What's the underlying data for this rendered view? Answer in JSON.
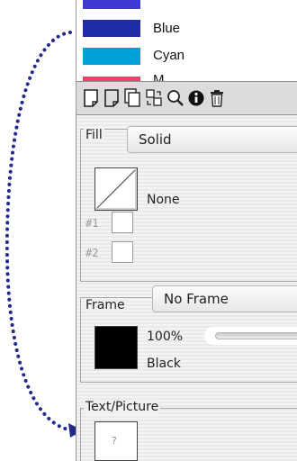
{
  "swatches": [
    {
      "label": "",
      "color": "#3f3ad6"
    },
    {
      "label": "Blue",
      "color": "#1f2aa7"
    },
    {
      "label": "Cyan",
      "color": "#00a2d8"
    },
    {
      "label": "M",
      "color": "#e6456c"
    }
  ],
  "toolbar": {
    "icons": [
      "new-page-icon",
      "page-icon",
      "duplicate-icon",
      "swap-icon",
      "zoom-icon",
      "info-icon",
      "trash-icon"
    ]
  },
  "fill": {
    "title": "Fill",
    "dropdown_value": "Solid",
    "color_name": "None",
    "slot1_label": "#1",
    "slot2_label": "#2"
  },
  "frame": {
    "title": "Frame",
    "dropdown_value": "No Frame",
    "opacity": "100%",
    "opacity_value": 100,
    "color_name": "Black"
  },
  "text_picture": {
    "title": "Text/Picture",
    "placeholder": "?"
  },
  "colors": {
    "frame_swatch": "#000000",
    "arrow": "#232a8a"
  }
}
